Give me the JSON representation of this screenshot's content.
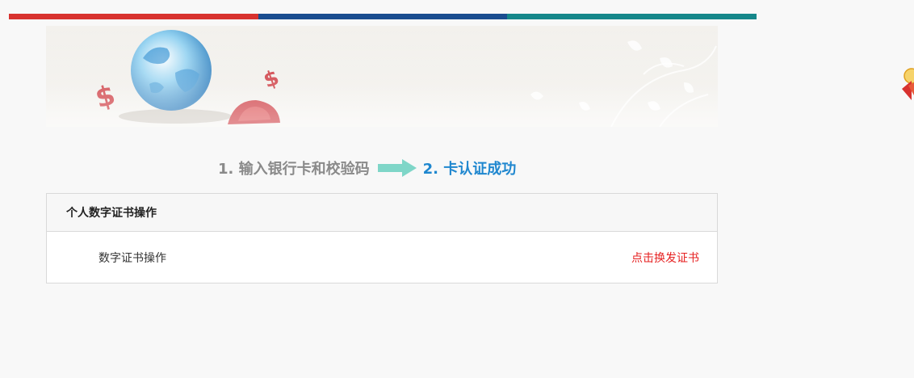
{
  "top_stripe": {
    "colors": [
      "#d8322f",
      "#1a4d8f",
      "#15878a"
    ]
  },
  "steps": {
    "step1": "1. 输入银行卡和校验码",
    "step2": "2. 卡认证成功"
  },
  "panel": {
    "title": "个人数字证书操作",
    "rows": [
      {
        "label": "数字证书操作",
        "action": "点击换发证书"
      }
    ]
  },
  "colors": {
    "accent_blue": "#1f87cf",
    "action_red": "#e62020"
  },
  "icons": {
    "banner": "globe-dollar-banner-image",
    "step_arrow": "right-arrow-icon",
    "side_badge": "floating-badge-icon"
  }
}
